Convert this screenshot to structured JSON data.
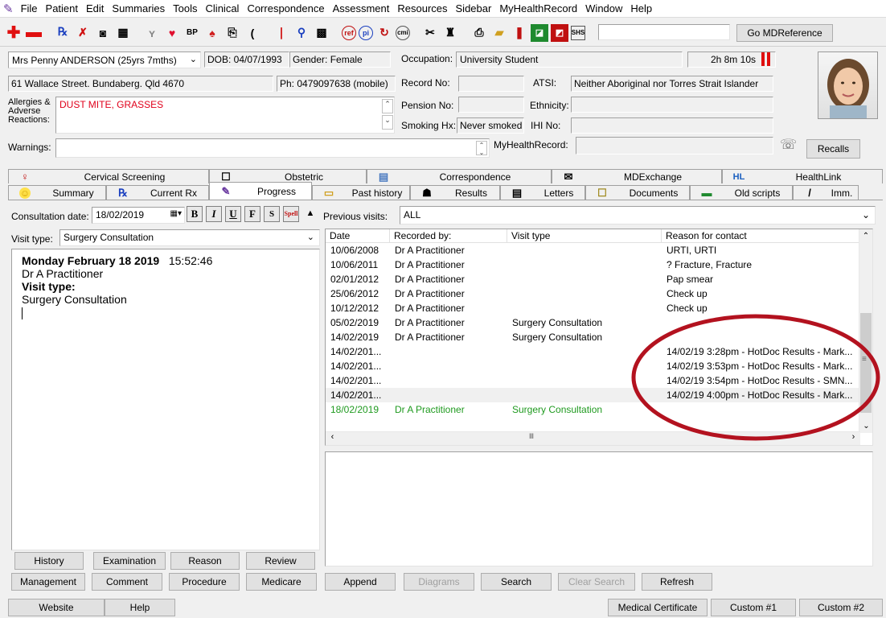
{
  "menu": [
    "File",
    "Patient",
    "Edit",
    "Summaries",
    "Tools",
    "Clinical",
    "Correspondence",
    "Assessment",
    "Resources",
    "Sidebar",
    "MyHealthRecord",
    "Window",
    "Help"
  ],
  "toolbar": {
    "search_value": "",
    "go_label": "Go MDReference",
    "shs_label": "SHS"
  },
  "patient": {
    "name": "Mrs Penny ANDERSON (25yrs 7mths)",
    "dob": "DOB: 04/07/1993",
    "gender": "Gender: Female",
    "occupation_label": "Occupation:",
    "occupation": "University Student",
    "timer": "2h 8m 10s",
    "address": "61 Wallace Street. Bundaberg. Qld  4670",
    "phone": "Ph: 0479097638 (mobile)",
    "record_label": "Record No:",
    "record": "",
    "atsi_label": "ATSI:",
    "atsi": "Neither Aboriginal nor Torres Strait Islander",
    "allergies_label": "Allergies & Adverse Reactions:",
    "allergies": "DUST MITE, GRASSES",
    "pension_label": "Pension No:",
    "pension": "",
    "ethnicity_label": "Ethnicity:",
    "ethnicity": "",
    "smoking_label": "Smoking Hx:",
    "smoking": "Never smoked",
    "ihi_label": "IHI No:",
    "ihi": "",
    "warnings_label": "Warnings:",
    "warnings": "",
    "mhr_label": "MyHealthRecord:",
    "mhr": "",
    "recalls_label": "Recalls"
  },
  "tabs_row1": [
    {
      "label": "Cervical Screening",
      "icon": "♀"
    },
    {
      "label": "Obstetric",
      "icon": "☐"
    },
    {
      "label": "Correspondence",
      "icon": "▤"
    },
    {
      "label": "MDExchange",
      "icon": "✉"
    },
    {
      "label": "HealthLink",
      "icon": "HL"
    }
  ],
  "tabs_row2": [
    {
      "label": "Summary",
      "icon": "☺"
    },
    {
      "label": "Current Rx",
      "icon": "℞"
    },
    {
      "label": "Progress",
      "icon": "✎"
    },
    {
      "label": "Past history",
      "icon": "▭"
    },
    {
      "label": "Results",
      "icon": "☗"
    },
    {
      "label": "Letters",
      "icon": "▤"
    },
    {
      "label": "Documents",
      "icon": "☐"
    },
    {
      "label": "Old scripts",
      "icon": "▬"
    },
    {
      "label": "Imm.",
      "icon": "/"
    }
  ],
  "consult": {
    "date_label": "Consultation date:",
    "date": "18/02/2019",
    "visit_type_label": "Visit type:",
    "visit_type": "Surgery Consultation",
    "note_date": "Monday February 18 2019",
    "note_time": "15:52:46",
    "note_doctor": "Dr A Practitioner",
    "note_vt_label": "Visit type:",
    "note_vt": "Surgery Consultation",
    "format_buttons": [
      "B",
      "I",
      "U",
      "F",
      "S",
      "Spell"
    ]
  },
  "previous": {
    "label": "Previous visits:",
    "filter": "ALL",
    "columns": [
      "Date",
      "Recorded by:",
      "Visit type",
      "Reason for contact"
    ],
    "rows": [
      {
        "date": "10/06/2008",
        "by": "Dr A Practitioner",
        "vt": "",
        "reason": "URTI, URTI"
      },
      {
        "date": "10/06/2011",
        "by": "Dr A Practitioner",
        "vt": "",
        "reason": "? Fracture, Fracture"
      },
      {
        "date": "02/01/2012",
        "by": "Dr A Practitioner",
        "vt": "",
        "reason": "Pap smear"
      },
      {
        "date": "25/06/2012",
        "by": "Dr A Practitioner",
        "vt": "",
        "reason": "Check up"
      },
      {
        "date": "10/12/2012",
        "by": "Dr A Practitioner",
        "vt": "",
        "reason": "Check up"
      },
      {
        "date": "05/02/2019",
        "by": "Dr A Practitioner",
        "vt": "Surgery Consultation",
        "reason": ""
      },
      {
        "date": "14/02/2019",
        "by": "Dr A Practitioner",
        "vt": "Surgery Consultation",
        "reason": ""
      },
      {
        "date": "14/02/201...",
        "by": "",
        "vt": "",
        "reason": "14/02/19  3:28pm - HotDoc Results - Mark..."
      },
      {
        "date": "14/02/201...",
        "by": "",
        "vt": "",
        "reason": "14/02/19  3:53pm - HotDoc Results - Mark..."
      },
      {
        "date": "14/02/201...",
        "by": "",
        "vt": "",
        "reason": "14/02/19  3:54pm - HotDoc Results - SMN..."
      },
      {
        "date": "14/02/201...",
        "by": "",
        "vt": "",
        "reason": "14/02/19  4:00pm - HotDoc Results - Mark..."
      },
      {
        "date": "18/02/2019",
        "by": "Dr A Practitioner",
        "vt": "Surgery Consultation",
        "reason": ""
      }
    ]
  },
  "buttons_row1": [
    "History",
    "Examination",
    "Reason",
    "Review"
  ],
  "buttons_row2": [
    "Management",
    "Comment",
    "Procedure",
    "Medicare"
  ],
  "action_buttons": [
    "Append",
    "Diagrams",
    "Search",
    "Clear Search",
    "Refresh"
  ],
  "status_buttons": [
    "Website",
    "Help",
    "Medical Certificate",
    "Custom #1",
    "Custom #2"
  ],
  "colors": {
    "highlight": "#b3121f",
    "allergy": "#e0001b",
    "green_row": "#1f9a1f",
    "timer_stop": "#e01010"
  }
}
